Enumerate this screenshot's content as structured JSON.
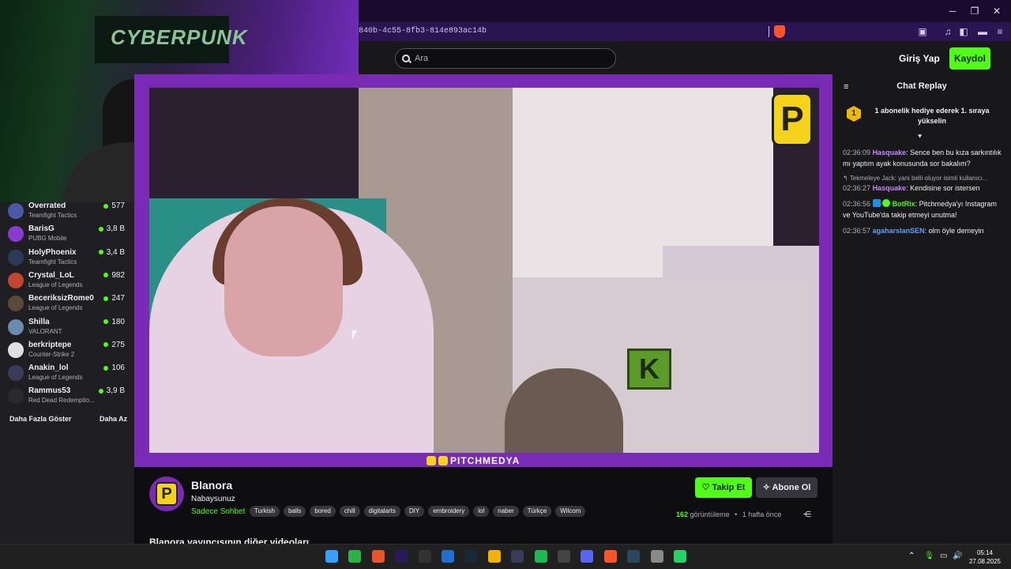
{
  "browser": {
    "url": "840b-4c55-8fb3-814e893ac14b",
    "window_controls": [
      "minimize-icon",
      "maximize-icon",
      "close-icon"
    ]
  },
  "header": {
    "search_placeholder": "Ara",
    "login_label": "Giriş Yap",
    "signup_label": "Kaydol",
    "accent_color": "#53fc18"
  },
  "sidebar": {
    "channels": [
      {
        "name": "Overrated",
        "game": "Teamfight Tactics",
        "viewers": "577",
        "avatar_color": "#4a5aa8"
      },
      {
        "name": "BarisG",
        "game": "PUBG Mobile",
        "viewers": "3,8 B",
        "avatar_color": "#8a3ad1"
      },
      {
        "name": "HolyPhoenix",
        "game": "Teamfight Tactics",
        "viewers": "3,4 B",
        "avatar_color": "#2c3a5a"
      },
      {
        "name": "Crystal_LoL",
        "game": "League of Legends",
        "viewers": "982",
        "avatar_color": "#c2452f"
      },
      {
        "name": "BeceriksizRome0",
        "game": "League of Legends",
        "viewers": "247",
        "avatar_color": "#5a4a3a"
      },
      {
        "name": "Shilla",
        "game": "VALORANT",
        "viewers": "180",
        "avatar_color": "#6a8ab0"
      },
      {
        "name": "berkriptepe",
        "game": "Counter-Strike 2",
        "viewers": "275",
        "avatar_color": "#e0e0e0"
      },
      {
        "name": "Anakin_lol",
        "game": "League of Legends",
        "viewers": "106",
        "avatar_color": "#3a3a5a"
      },
      {
        "name": "Rammus53",
        "game": "Red Dead Redemptio...",
        "viewers": "3,9 B",
        "avatar_color": "#2a2a2a"
      }
    ],
    "show_more": "Daha Fazla Göster",
    "show_less": "Daha Az"
  },
  "webcam": {
    "poster_text": "CYBERPUNK"
  },
  "video": {
    "watermark": "PITCHMEDYA",
    "logo_letter": "P",
    "sign_letter": "K"
  },
  "chat": {
    "title": "Chat Replay",
    "pinned": {
      "rank": "1",
      "text": "1 abonelik hediye ederek 1. sıraya yükselin"
    },
    "messages": [
      {
        "ts": "02:36:09",
        "user": "Hasquake",
        "user_color": "#c58af9",
        "text": "Sence ben bu kıza sarkıntılık mı yaptım ayak konusunda sor bakalım?"
      },
      {
        "reply": "Tekmeleye Jack: yani belli oluyor isimli kullanıcı..."
      },
      {
        "ts": "02:36:27",
        "user": "Hasquake",
        "user_color": "#c58af9",
        "text": "Kendisine sor istersen"
      },
      {
        "ts": "02:36:56",
        "user": "BotRix",
        "user_color": "#53fc18",
        "text": "Pitchmedya'yı Instagram ve YouTube'da takip etmeyi unutma!"
      },
      {
        "ts": "02:36:57",
        "user": "agaharslanSEN",
        "user_color": "#5aa0ff",
        "text": "olm öyle demeyin"
      }
    ]
  },
  "stream": {
    "channel_name": "Blanora",
    "subtitle": "Nabaysunuz",
    "category": "Sadece Sohbet",
    "tags": [
      "Turkish",
      "balls",
      "bored",
      "chill",
      "digitalarts",
      "DIY",
      "embroidery",
      "lol",
      "naber",
      "Türkçe",
      "Wilcom"
    ],
    "follow_label": "Takip Et",
    "subscribe_label": "Abone Ol",
    "views_count": "162",
    "views_label": "görüntüleme",
    "time_ago": "1 hafta önce",
    "other_videos": "Blanora yayıncısının diğer videoları"
  },
  "taskbar": {
    "time": "05:14",
    "date": "27.08.2025",
    "apps": [
      {
        "name": "windows-start-icon",
        "color": "#3aa0ff"
      },
      {
        "name": "xbox-icon",
        "color": "#2bb34a"
      },
      {
        "name": "app-icon",
        "color": "#e8552a"
      },
      {
        "name": "premiere-icon",
        "color": "#2a1a5a"
      },
      {
        "name": "epic-games-icon",
        "color": "#333333"
      },
      {
        "name": "remote-desktop-icon",
        "color": "#1f6fd1"
      },
      {
        "name": "steam-icon",
        "color": "#1b2838"
      },
      {
        "name": "file-explorer-icon",
        "color": "#f0b400"
      },
      {
        "name": "obs-icon",
        "color": "#3a3a5a"
      },
      {
        "name": "spotify-icon",
        "color": "#1db954"
      },
      {
        "name": "github-icon",
        "color": "#444444"
      },
      {
        "name": "discord-icon",
        "color": "#5865f2"
      },
      {
        "name": "brave-icon",
        "color": "#fb542b"
      },
      {
        "name": "steam-2-icon",
        "color": "#2a475e"
      },
      {
        "name": "settings-icon",
        "color": "#8a8a8a"
      },
      {
        "name": "whatsapp-icon",
        "color": "#25d366"
      }
    ]
  }
}
